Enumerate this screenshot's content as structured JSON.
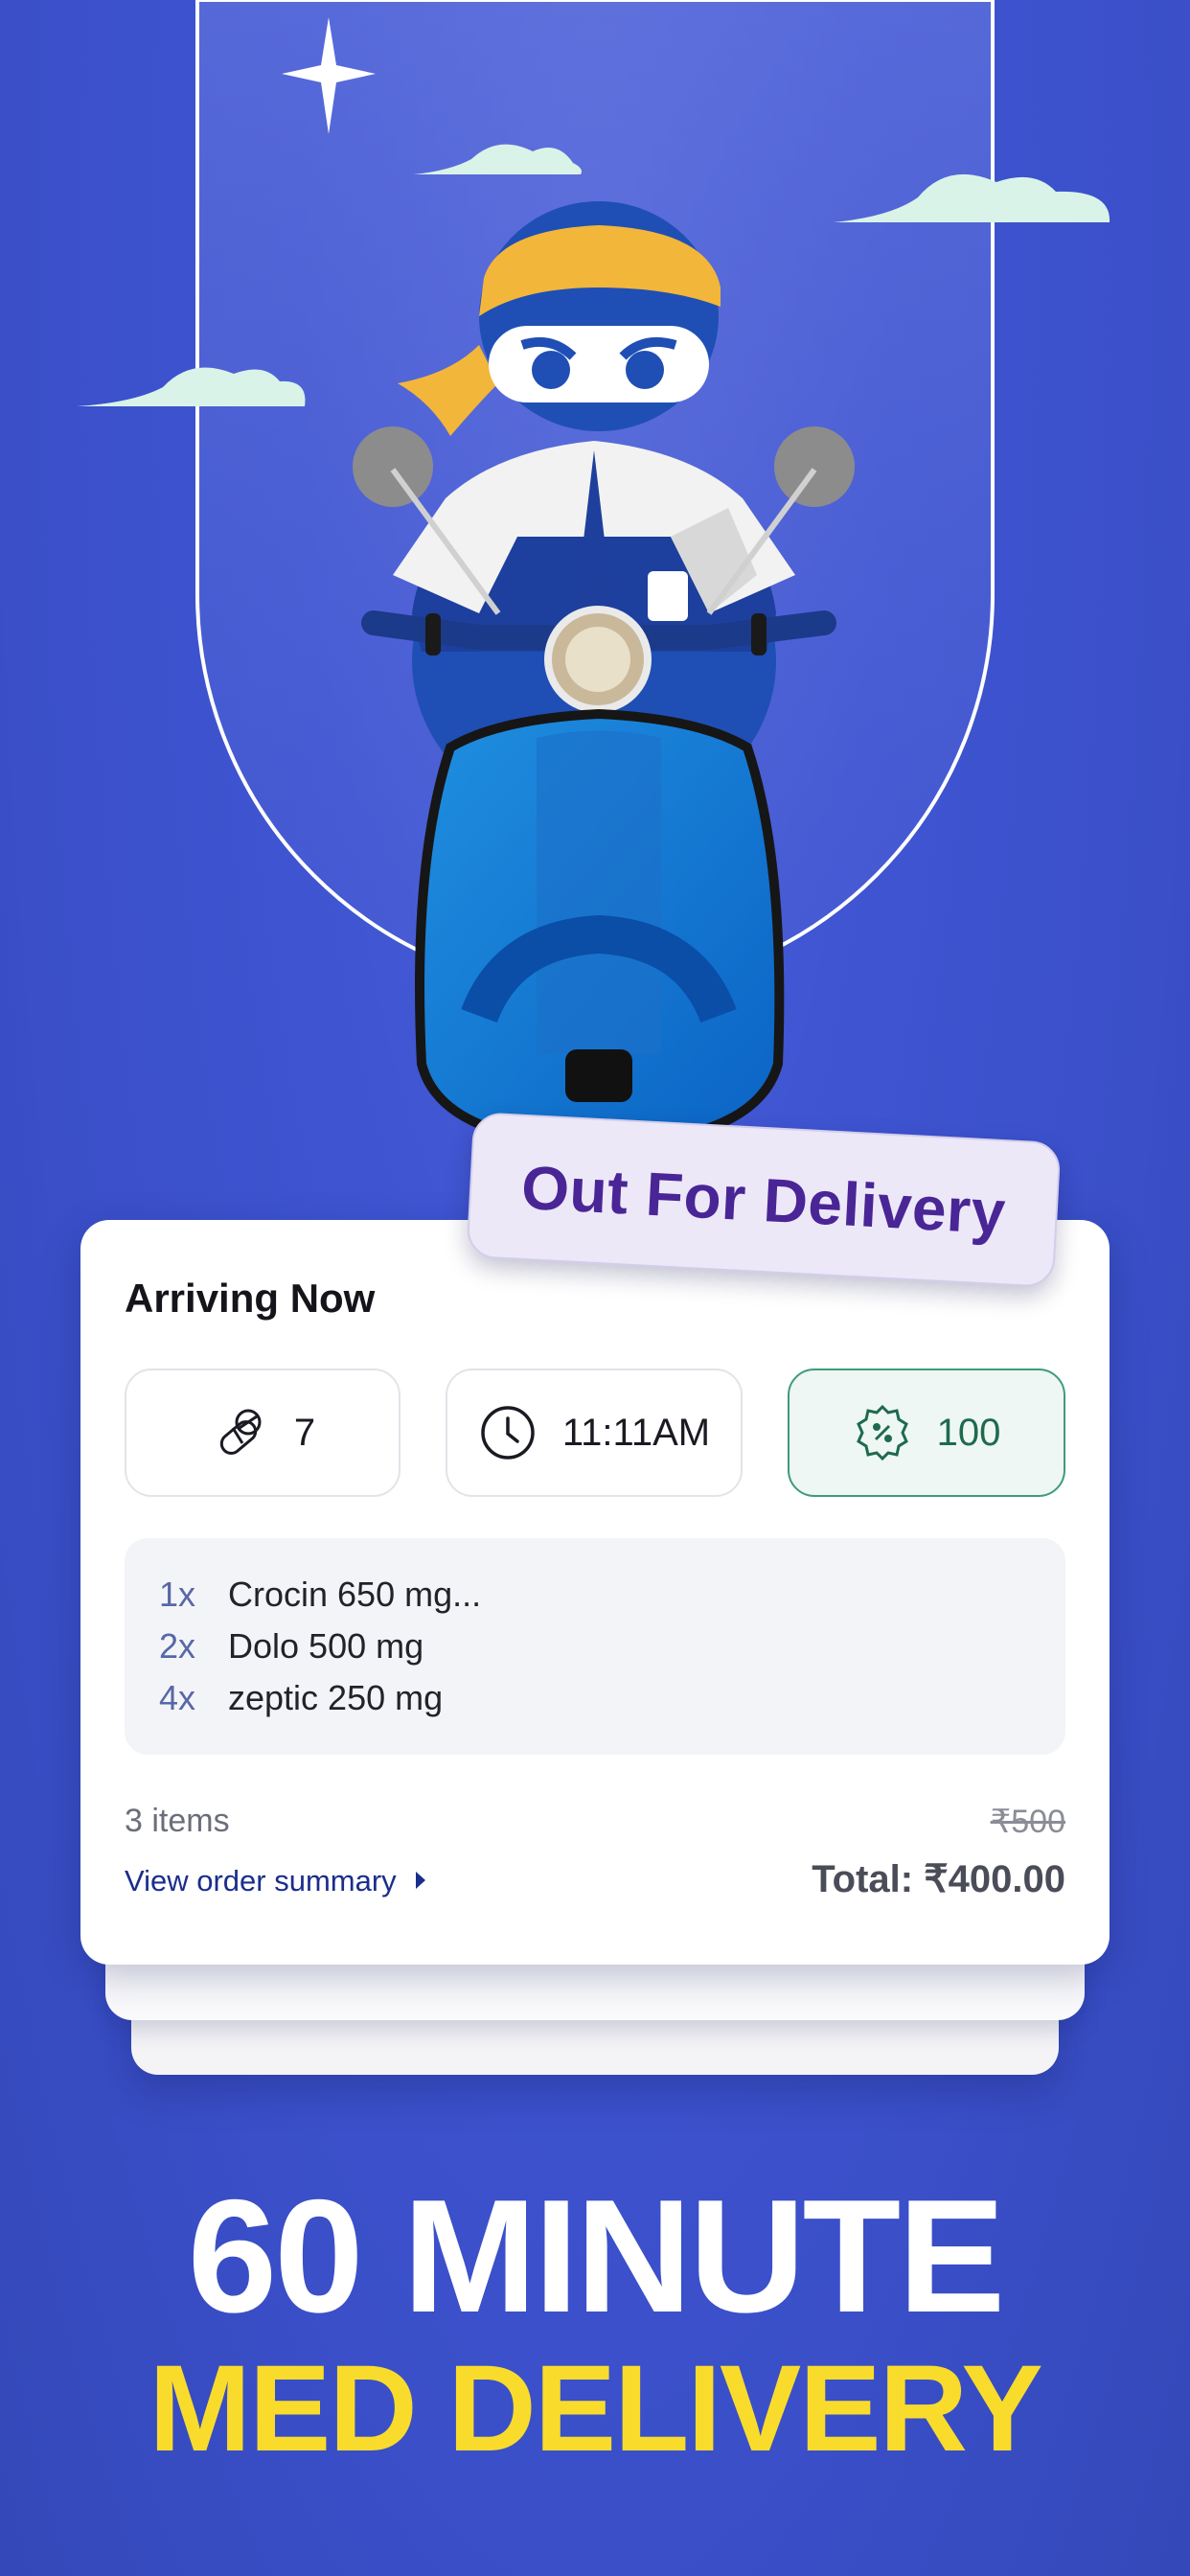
{
  "status_tag": "Out For Delivery",
  "card": {
    "title": "Arriving Now",
    "stats": [
      {
        "icon": "pill-icon",
        "value": "7"
      },
      {
        "icon": "clock-icon",
        "value": "11:11AM"
      },
      {
        "icon": "discount-badge-icon",
        "value": "100"
      }
    ],
    "items": [
      {
        "qty": "1x",
        "name": "Crocin 650 mg..."
      },
      {
        "qty": "2x",
        "name": "Dolo 500 mg"
      },
      {
        "qty": "4x",
        "name": "zeptic 250 mg"
      }
    ],
    "item_count": "3 items",
    "original_price": "₹500",
    "view_summary": "View order summary",
    "total": "Total: ₹400.00"
  },
  "headline": {
    "line1": "60 MINUTE",
    "line2": "MED DELIVERY"
  },
  "colors": {
    "background": "#3f55d2",
    "tag_text": "#4a2596",
    "headline_yellow": "#f9dc2b",
    "offer_green": "#3e9c77",
    "link_blue": "#1a2e8c"
  }
}
